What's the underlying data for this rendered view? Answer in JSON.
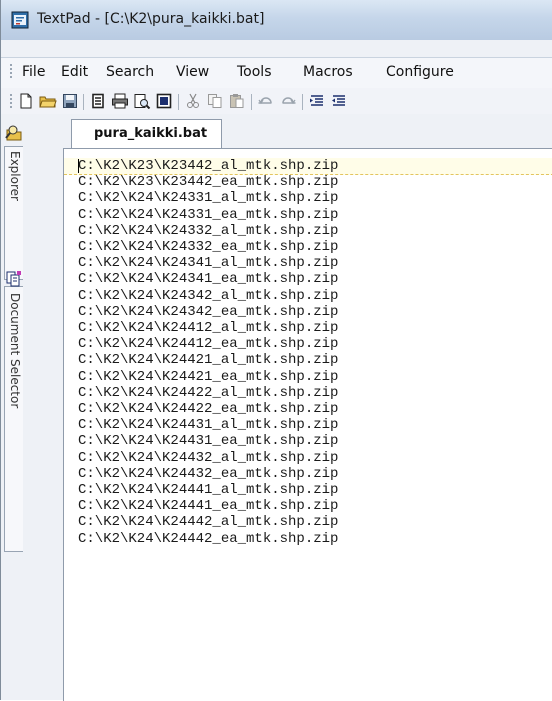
{
  "window": {
    "title": "TextPad - [C:\\K2\\pura_kaikki.bat]"
  },
  "menu": {
    "items": [
      "File",
      "Edit",
      "Search",
      "View",
      "Tools",
      "Macros",
      "Configure"
    ]
  },
  "toolbar": {
    "buttons": [
      "new-file-icon",
      "open-folder-icon",
      "save-icon",
      "manage-files-icon",
      "print-icon",
      "print-preview-icon",
      "select-all-icon",
      "cut-icon",
      "copy-icon",
      "paste-icon",
      "undo-icon",
      "redo-icon",
      "indent-icon",
      "outdent-icon"
    ]
  },
  "side_tabs": {
    "explorer": "Explorer",
    "document_selector": "Document Selector"
  },
  "document_tab": {
    "label": "pura_kaikki.bat"
  },
  "editor": {
    "lines": [
      "C:\\K2\\K23\\K23442_al_mtk.shp.zip",
      "C:\\K2\\K23\\K23442_ea_mtk.shp.zip",
      "C:\\K2\\K24\\K24331_al_mtk.shp.zip",
      "C:\\K2\\K24\\K24331_ea_mtk.shp.zip",
      "C:\\K2\\K24\\K24332_al_mtk.shp.zip",
      "C:\\K2\\K24\\K24332_ea_mtk.shp.zip",
      "C:\\K2\\K24\\K24341_al_mtk.shp.zip",
      "C:\\K2\\K24\\K24341_ea_mtk.shp.zip",
      "C:\\K2\\K24\\K24342_al_mtk.shp.zip",
      "C:\\K2\\K24\\K24342_ea_mtk.shp.zip",
      "C:\\K2\\K24\\K24412_al_mtk.shp.zip",
      "C:\\K2\\K24\\K24412_ea_mtk.shp.zip",
      "C:\\K2\\K24\\K24421_al_mtk.shp.zip",
      "C:\\K2\\K24\\K24421_ea_mtk.shp.zip",
      "C:\\K2\\K24\\K24422_al_mtk.shp.zip",
      "C:\\K2\\K24\\K24422_ea_mtk.shp.zip",
      "C:\\K2\\K24\\K24431_al_mtk.shp.zip",
      "C:\\K2\\K24\\K24431_ea_mtk.shp.zip",
      "C:\\K2\\K24\\K24432_al_mtk.shp.zip",
      "C:\\K2\\K24\\K24432_ea_mtk.shp.zip",
      "C:\\K2\\K24\\K24441_al_mtk.shp.zip",
      "C:\\K2\\K24\\K24441_ea_mtk.shp.zip",
      "C:\\K2\\K24\\K24442_al_mtk.shp.zip",
      "C:\\K2\\K24\\K24442_ea_mtk.shp.zip"
    ]
  }
}
